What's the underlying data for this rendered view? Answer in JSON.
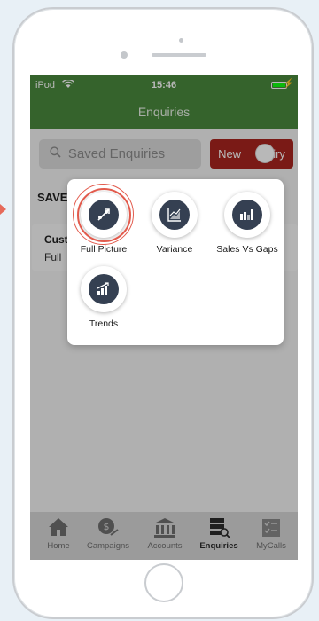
{
  "status": {
    "carrier": "iPod",
    "time": "15:46"
  },
  "header": {
    "title": "Enquiries"
  },
  "search": {
    "placeholder": "Saved Enquiries"
  },
  "new_button": {
    "label": "New Enquiry",
    "visible_label": "New      quiry"
  },
  "list": {
    "section_label": "SAVE",
    "item": {
      "title": "Cust",
      "subtitle": "Full"
    }
  },
  "popup": {
    "options": [
      {
        "label": "Full Picture",
        "icon": "full-picture-icon"
      },
      {
        "label": "Variance",
        "icon": "variance-chart-icon"
      },
      {
        "label": "Sales Vs Gaps",
        "icon": "sales-gaps-icon"
      },
      {
        "label": "Trends",
        "icon": "trends-icon"
      }
    ]
  },
  "tabbar": {
    "active": "Enquiries",
    "items": [
      {
        "label": "Home",
        "icon": "home-icon"
      },
      {
        "label": "Campaigns",
        "icon": "campaigns-icon"
      },
      {
        "label": "Accounts",
        "icon": "bank-icon"
      },
      {
        "label": "Enquiries",
        "icon": "enquiries-icon"
      },
      {
        "label": "MyCalls",
        "icon": "checklist-icon"
      }
    ]
  },
  "colors": {
    "header": "#4a8a3d",
    "new_button": "#a9251f",
    "icon_disc": "#354052",
    "highlight_ring": "#e25b4d",
    "tabbar": "#d7d7d7"
  }
}
